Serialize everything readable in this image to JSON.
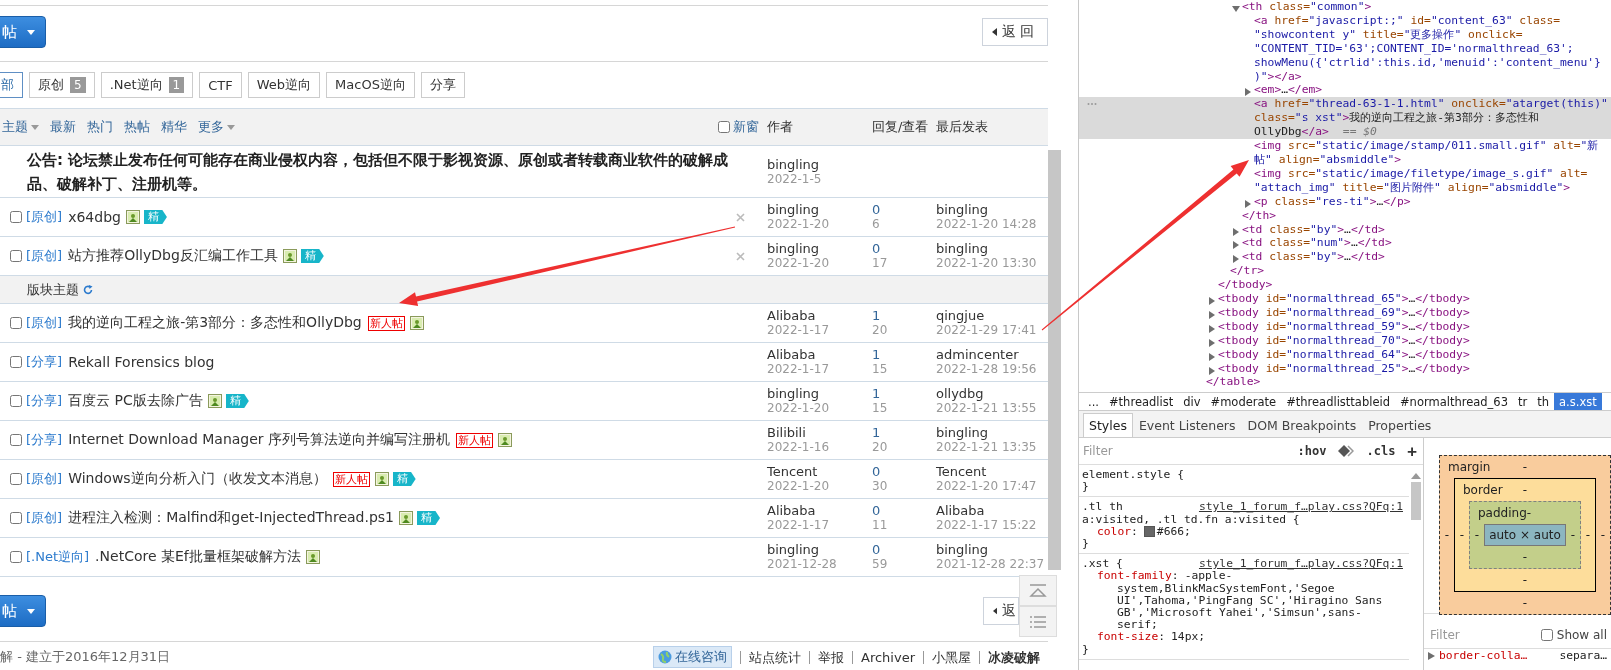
{
  "page": {
    "top_bar": {
      "post_button": "帖",
      "back_button": "返 回"
    },
    "filter_tabs": [
      {
        "label": "部",
        "selected": true
      },
      {
        "label": "原创",
        "count": "5",
        "selected": false
      },
      {
        "label": ".Net逆向",
        "count": "1",
        "selected": false
      },
      {
        "label": "CTF",
        "selected": false
      },
      {
        "label": "Web逆向",
        "selected": false
      },
      {
        "label": "MacOS逆向",
        "selected": false
      },
      {
        "label": "分享",
        "selected": false
      }
    ],
    "list_header": {
      "sort_menu": "主题",
      "links": [
        "最新",
        "热门",
        "热帖",
        "精华"
      ],
      "more_menu": "更多",
      "new_window": {
        "label": "新窗",
        "checked": false
      },
      "columns": [
        "作者",
        "回复/查看",
        "最后发表"
      ]
    },
    "announcement": {
      "text": "公告: 论坛禁止发布任何可能存在商业侵权内容，包括但不限于影视资源、原创或者转载商业软件的破解成品、破解补丁、注册机等。",
      "author": "bingling",
      "date": "2022-1-5"
    },
    "pinned_threads": [
      {
        "checked": false,
        "tag": "[原创]",
        "title": "x64dbg",
        "badges": [
          {
            "kind": "image"
          },
          {
            "kind": "digest",
            "label": "精"
          }
        ],
        "author": "bingling",
        "date": "2022-1-20",
        "replies": "0",
        "views": "6",
        "last_user": "bingling",
        "last_time": "2022-1-20 14:28"
      },
      {
        "checked": false,
        "tag": "[原创]",
        "title": "站方推荐OllyDbg反汇编工作工具",
        "badges": [
          {
            "kind": "image"
          },
          {
            "kind": "digest",
            "label": "精"
          }
        ],
        "author": "bingling",
        "date": "2022-1-20",
        "replies": "0",
        "views": "17",
        "last_user": "bingling",
        "last_time": "2022-1-20 13:30"
      }
    ],
    "section_label": "版块主题",
    "threads": [
      {
        "checked": false,
        "tag": "[原创]",
        "title": "我的逆向工程之旅-第3部分：多态性和OllyDbg",
        "badges": [
          {
            "kind": "new",
            "label": "新人帖"
          },
          {
            "kind": "image"
          }
        ],
        "author": "Alibaba",
        "date": "2022-1-17",
        "replies": "1",
        "views": "20",
        "last_user": "qingjue",
        "last_time": "2022-1-29 17:41"
      },
      {
        "checked": false,
        "tag": "[分享]",
        "title": "Rekall Forensics blog",
        "author": "Alibaba",
        "date": "2022-1-17",
        "replies": "1",
        "views": "15",
        "last_user": "admincenter",
        "last_time": "2022-1-28 19:56"
      },
      {
        "checked": false,
        "tag": "[分享]",
        "title": "百度云 PC版去除广告",
        "badges": [
          {
            "kind": "image"
          },
          {
            "kind": "digest",
            "label": "精"
          }
        ],
        "author": "bingling",
        "date": "2022-1-20",
        "replies": "1",
        "views": "15",
        "last_user": "ollydbg",
        "last_time": "2022-1-21 13:55"
      },
      {
        "checked": false,
        "tag": "[分享]",
        "title": "Internet Download Manager 序列号算法逆向并编写注册机",
        "badges": [
          {
            "kind": "new",
            "label": "新人帖"
          },
          {
            "kind": "image"
          }
        ],
        "author": "Bilibili",
        "date": "2022-1-16",
        "replies": "1",
        "views": "20",
        "last_user": "bingling",
        "last_time": "2022-1-21 13:35"
      },
      {
        "checked": false,
        "tag": "[原创]",
        "title": "Windows逆向分析入门（收发文本消息）",
        "badges": [
          {
            "kind": "new",
            "label": "新人帖"
          },
          {
            "kind": "image"
          },
          {
            "kind": "digest",
            "label": "精"
          }
        ],
        "author": "Tencent",
        "date": "2022-1-20",
        "replies": "0",
        "views": "30",
        "last_user": "Tencent",
        "last_time": "2022-1-20 17:47"
      },
      {
        "checked": false,
        "tag": "[原创]",
        "title": "进程注入检测：Malfind和get-InjectedThread.ps1",
        "badges": [
          {
            "kind": "image"
          },
          {
            "kind": "digest",
            "label": "精"
          }
        ],
        "author": "Alibaba",
        "date": "2022-1-17",
        "replies": "0",
        "views": "11",
        "last_user": "Alibaba",
        "last_time": "2022-1-17 15:22"
      },
      {
        "checked": false,
        "tag": "[.Net逆向]",
        "title": ".NetCore 某Ef批量框架破解方法",
        "badges": [
          {
            "kind": "image"
          }
        ],
        "author": "bingling",
        "date": "2021-12-28",
        "replies": "0",
        "views": "59",
        "last_user": "bingling",
        "last_time": "2021-12-28 22:37"
      }
    ],
    "bottom_bar": {
      "post_button": "帖",
      "back_button": "返"
    },
    "footer": {
      "site_note": "解 - 建立于2016年12月31日",
      "chat_button": "在线咨询",
      "links": [
        "站点统计",
        "举报",
        "Archiver",
        "小黑屋"
      ],
      "brand": "冰凌破解"
    }
  },
  "devtools": {
    "dom_tree": [
      {
        "closing": "</table>",
        "children": [
          {
            "closing": "</tbody>",
            "children": [
              {
                "closing": "</tr>",
                "children": [
                  {
                    "text": "<th class=\"common\">",
                    "expanded": true,
                    "selected": false,
                    "closing": "</th>",
                    "children": [
                      {
                        "text": "<a href=\"javascript:;\" id=\"content_63\" class=\n\"showcontent y\" title=\"更多操作\" onclick=\n\"CONTENT_TID='63';CONTENT_ID='normalthread_63';\nshowMenu({'ctrlid':this.id,'menuid':'content_menu'}\n)\"></a>",
                        "selected": false
                      },
                      {
                        "text": "<em>…</em>",
                        "expanded": false,
                        "selected": false
                      },
                      {
                        "text": "<a href=\"thread-63-1-1.html\" onclick=\"atarget(this)\"\nclass=\"s xst\">我的逆向工程之旅-第3部分：多态性和\nOllyDbg</a>",
                        "suffix": "== $0",
                        "selected": true
                      },
                      {
                        "text": "<img src=\"static/image/stamp/011.small.gif\" alt=\"新帖\" align=\"absmiddle\">",
                        "selected": false
                      },
                      {
                        "text": "<img src=\"static/image/filetype/image_s.gif\" alt=\n\"attach_img\" title=\"图片附件\" align=\"absmiddle\">",
                        "selected": false
                      },
                      {
                        "text": "<p class=\"res-ti\">…</p>",
                        "expanded": false,
                        "selected": false
                      }
                    ]
                  },
                  {
                    "text": "<td class=\"by\">…</td>",
                    "expanded": false,
                    "selected": false
                  },
                  {
                    "text": "<td class=\"num\">…</td>",
                    "expanded": false,
                    "selected": false
                  },
                  {
                    "text": "<td class=\"by\">…</td>",
                    "expanded": false,
                    "selected": false
                  }
                ]
              }
            ]
          },
          {
            "text": "<tbody id=\"normalthread_65\">…</tbody>",
            "expanded": false,
            "selected": false
          },
          {
            "text": "<tbody id=\"normalthread_69\">…</tbody>",
            "expanded": false,
            "selected": false
          },
          {
            "text": "<tbody id=\"normalthread_59\">…</tbody>",
            "expanded": false,
            "selected": false
          },
          {
            "text": "<tbody id=\"normalthread_70\">…</tbody>",
            "expanded": false,
            "selected": false
          },
          {
            "text": "<tbody id=\"normalthread_64\">…</tbody>",
            "expanded": false,
            "selected": false
          },
          {
            "text": "<tbody id=\"normalthread_25\">…</tbody>",
            "expanded": false,
            "selected": false
          }
        ]
      }
    ],
    "breadcrumbs": [
      {
        "label": "...",
        "selected": false
      },
      {
        "label": "#threadlist",
        "selected": false
      },
      {
        "label": "div",
        "selected": false
      },
      {
        "label": "#moderate",
        "selected": false
      },
      {
        "label": "#threadlisttableid",
        "selected": false
      },
      {
        "label": "#normalthread_63",
        "selected": false
      },
      {
        "label": "tr",
        "selected": false
      },
      {
        "label": "th",
        "selected": false
      },
      {
        "label": "a.s.xst",
        "selected": true
      }
    ],
    "tabs": [
      {
        "label": "Styles",
        "selected": true
      },
      {
        "label": "Event Listeners",
        "selected": false
      },
      {
        "label": "DOM Breakpoints",
        "selected": false
      },
      {
        "label": "Properties",
        "selected": false
      }
    ],
    "styles": {
      "filter_placeholder": "Filter",
      "hov_button": ":hov",
      "cls_button": ".cls",
      "add_button": "+",
      "rules": [
        {
          "selector_lines": [
            "element.style {"
          ],
          "close": "}"
        },
        {
          "selector_lines": [
            ".tl th",
            "a:visited, .tl td.fn a:visited {"
          ],
          "source": "style_1_forum_f…play.css?QFq:1",
          "properties": [
            {
              "name": "color",
              "colon": ":",
              "swatch": true,
              "value": "#666;"
            }
          ],
          "close": "}"
        },
        {
          "selector_lines": [
            ".xst {"
          ],
          "source": "style_1_forum_f…play.css?QFq:1",
          "properties": [
            {
              "name": "font-family",
              "colon": ":",
              "value": "-apple-\nsystem,BlinkMacSystemFont,'Segoe\nUI',Tahoma,'PingFang SC','Hiragino Sans\nGB','Microsoft Yahei','Simsun',sans-\nserif;"
            },
            {
              "name": "font-size",
              "colon": ":",
              "value": "14px;"
            }
          ],
          "close": "}"
        }
      ]
    },
    "box_model": {
      "margin": {
        "label": "margin",
        "top": "-",
        "right": "-",
        "bottom": "-",
        "left": "-"
      },
      "border": {
        "label": "border",
        "top": "-",
        "right": "-",
        "bottom": "-",
        "left": "-"
      },
      "padding": {
        "label": "padding",
        "top": "-",
        "right": "-",
        "bottom": "-",
        "left": "-"
      },
      "content": "auto × auto"
    },
    "computed": {
      "filter_placeholder": "Filter",
      "show_all": {
        "label": "Show all",
        "checked": false
      },
      "rows": [
        {
          "name": "border-colla…",
          "value": "separa…"
        }
      ]
    }
  }
}
